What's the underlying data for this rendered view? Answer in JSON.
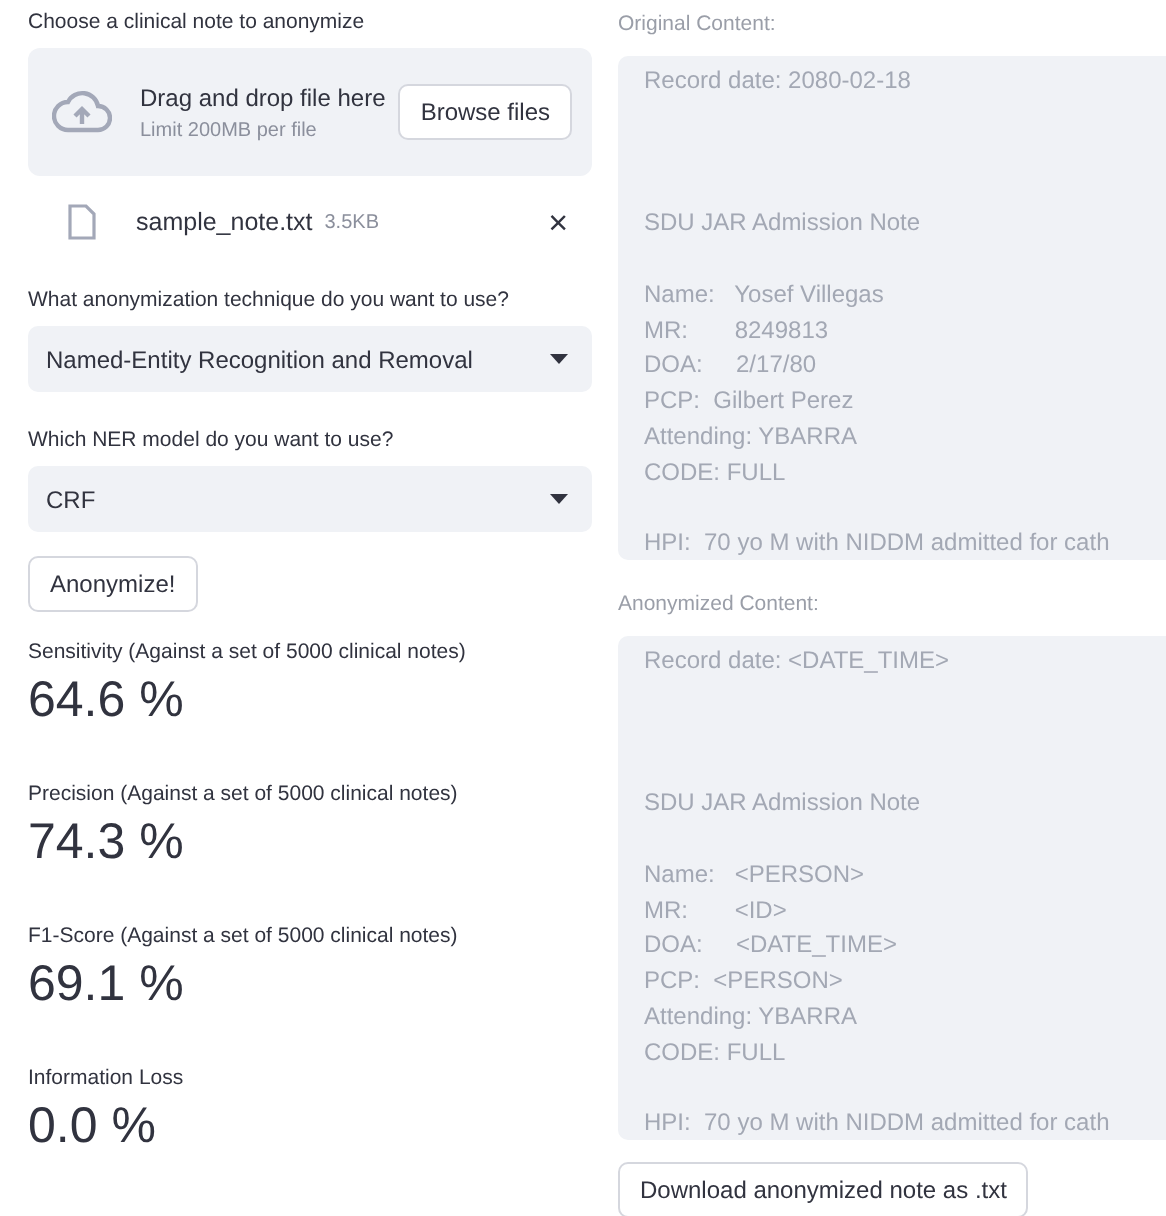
{
  "uploader": {
    "label": "Choose a clinical note to anonymize",
    "drop_text": "Drag and drop file here",
    "limit": "Limit 200MB per file",
    "browse_button": "Browse files",
    "file": {
      "name": "sample_note.txt",
      "size": "3.5KB",
      "remove": "×"
    }
  },
  "technique": {
    "label": "What anonymization technique do you want to use?",
    "value": "Named-Entity Recognition and Removal"
  },
  "model": {
    "label": "Which NER model do you want to use?",
    "value": "CRF"
  },
  "run_button": "Anonymize!",
  "metrics": [
    {
      "label": "Sensitivity (Against a set of 5000 clinical notes)",
      "value": "64.6 %"
    },
    {
      "label": "Precision (Against a set of 5000 clinical notes)",
      "value": "74.3 %"
    },
    {
      "label": "F1-Score (Against a set of 5000 clinical notes)",
      "value": "69.1 %"
    },
    {
      "label": "Information Loss",
      "value": "0.0 %"
    }
  ],
  "original": {
    "label": "Original Content:",
    "disabled": true,
    "value": "Record date: 2080-02-18\n\n\n\nSDU JAR Admission Note\n\nName:   Yosef Villegas\nMR:       8249813\nDOA:     2/17/80\nPCP:  Gilbert Perez\nAttending: YBARRA\nCODE: FULL\n\nHPI:  70 yo M with NIDDM admitted for cath"
  },
  "anonymized": {
    "label": "Anonymized Content:",
    "disabled": true,
    "value": "Record date: <DATE_TIME>\n\n\n\nSDU JAR Admission Note\n\nName:   <PERSON>\nMR:       <ID>\nDOA:     <DATE_TIME>\nPCP:  <PERSON>\nAttending: YBARRA\nCODE: FULL\n\nHPI:  70 yo M with NIDDM admitted for cath"
  },
  "download_button": "Download anonymized note as .txt"
}
